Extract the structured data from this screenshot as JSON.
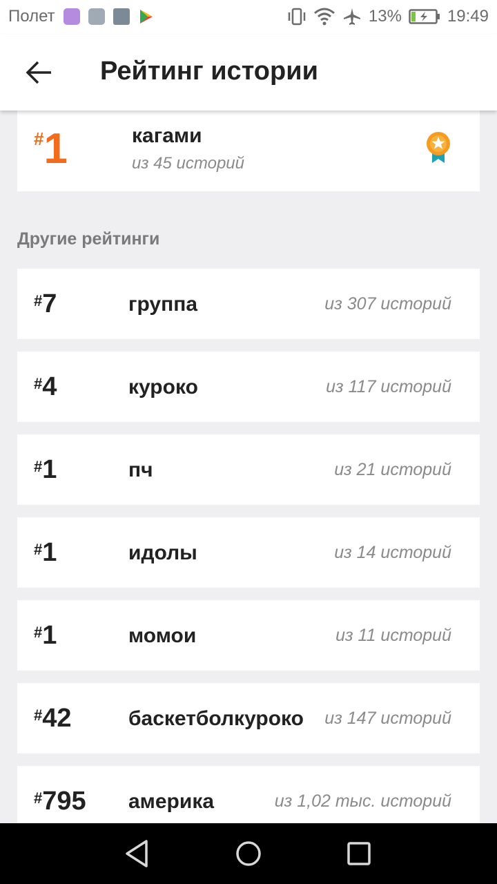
{
  "status_bar": {
    "carrier": "Полет",
    "battery": "13%",
    "time": "19:49",
    "icons": [
      "messages-icon",
      "gallery-icon",
      "avatar-icon",
      "play-store-icon",
      "vibrate-icon",
      "wifi-icon",
      "airplane-icon",
      "battery-charging-icon"
    ]
  },
  "app_bar": {
    "title": "Рейтинг истории",
    "back_icon": "arrow-back-icon"
  },
  "top_ranking": {
    "hash": "#",
    "rank": "1",
    "tag": "кагами",
    "count_text": "из 45 историй",
    "badge_icon": "medal-star-icon",
    "accent_color": "#f26c1d"
  },
  "other": {
    "title": "Другие рейтинги",
    "items": [
      {
        "hash": "#",
        "rank": "7",
        "tag": "группа",
        "count_text": "из 307 историй"
      },
      {
        "hash": "#",
        "rank": "4",
        "tag": "куроко",
        "count_text": "из 117 историй"
      },
      {
        "hash": "#",
        "rank": "1",
        "tag": "пч",
        "count_text": "из 21 историй"
      },
      {
        "hash": "#",
        "rank": "1",
        "tag": "идолы",
        "count_text": "из 14 историй"
      },
      {
        "hash": "#",
        "rank": "1",
        "tag": "момои",
        "count_text": "из 11 историй"
      },
      {
        "hash": "#",
        "rank": "42",
        "tag": "баскетболкуроко",
        "count_text": "из 147 историй"
      },
      {
        "hash": "#",
        "rank": "795",
        "tag": "америка",
        "count_text": "из 1,02 тыс. историй"
      }
    ]
  },
  "nav_bar": {
    "icons": [
      "nav-back-icon",
      "nav-home-icon",
      "nav-recents-icon"
    ]
  }
}
